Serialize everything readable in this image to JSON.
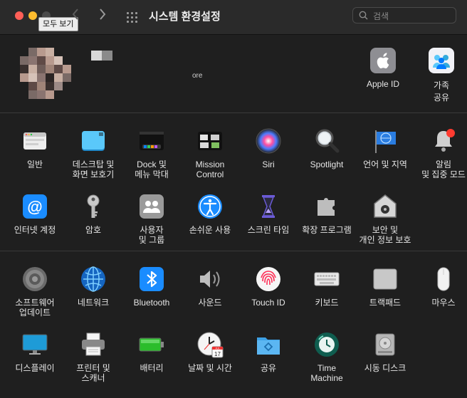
{
  "window": {
    "title": "시스템 환경설정",
    "tooltip": "모두 보기",
    "back_icon": "chevron-left-icon",
    "forward_icon": "chevron-right-icon"
  },
  "search": {
    "placeholder": "검색",
    "value": ""
  },
  "account": {
    "subtitle": "ore",
    "items": [
      {
        "label": "Apple ID",
        "icon": "apple-id-icon"
      },
      {
        "label": "가족\n공유",
        "icon": "family-sharing-icon"
      }
    ]
  },
  "section1": [
    {
      "label": "일반",
      "icon": "general-icon"
    },
    {
      "label": "데스크탑 및\n화면 보호기",
      "icon": "desktop-screensaver-icon"
    },
    {
      "label": "Dock 및\n메뉴 막대",
      "icon": "dock-menubar-icon"
    },
    {
      "label": "Mission\nControl",
      "icon": "mission-control-icon"
    },
    {
      "label": "Siri",
      "icon": "siri-icon"
    },
    {
      "label": "Spotlight",
      "icon": "spotlight-icon"
    },
    {
      "label": "언어 및 지역",
      "icon": "language-region-icon"
    },
    {
      "label": "알림\n및 집중 모드",
      "icon": "notifications-icon"
    },
    {
      "label": "인터넷 계정",
      "icon": "internet-accounts-icon"
    },
    {
      "label": "암호",
      "icon": "passwords-icon"
    },
    {
      "label": "사용자\n및 그룹",
      "icon": "users-groups-icon"
    },
    {
      "label": "손쉬운 사용",
      "icon": "accessibility-icon"
    },
    {
      "label": "스크린 타임",
      "icon": "screen-time-icon"
    },
    {
      "label": "확장 프로그램",
      "icon": "extensions-icon"
    },
    {
      "label": "보안 및\n개인 정보 보호",
      "icon": "security-privacy-icon"
    }
  ],
  "section2": [
    {
      "label": "소프트웨어\n업데이트",
      "icon": "software-update-icon"
    },
    {
      "label": "네트워크",
      "icon": "network-icon"
    },
    {
      "label": "Bluetooth",
      "icon": "bluetooth-icon"
    },
    {
      "label": "사운드",
      "icon": "sound-icon"
    },
    {
      "label": "Touch ID",
      "icon": "touch-id-icon"
    },
    {
      "label": "키보드",
      "icon": "keyboard-icon"
    },
    {
      "label": "트랙패드",
      "icon": "trackpad-icon"
    },
    {
      "label": "마우스",
      "icon": "mouse-icon"
    },
    {
      "label": "디스플레이",
      "icon": "displays-icon"
    },
    {
      "label": "프린터 및\n스캐너",
      "icon": "printers-scanners-icon"
    },
    {
      "label": "배터리",
      "icon": "battery-icon"
    },
    {
      "label": "날짜 및 시간",
      "icon": "date-time-icon"
    },
    {
      "label": "공유",
      "icon": "sharing-icon"
    },
    {
      "label": "Time\nMachine",
      "icon": "time-machine-icon"
    },
    {
      "label": "시동 디스크",
      "icon": "startup-disk-icon"
    }
  ],
  "calendar_day": "17",
  "calendar_month": "JUL"
}
